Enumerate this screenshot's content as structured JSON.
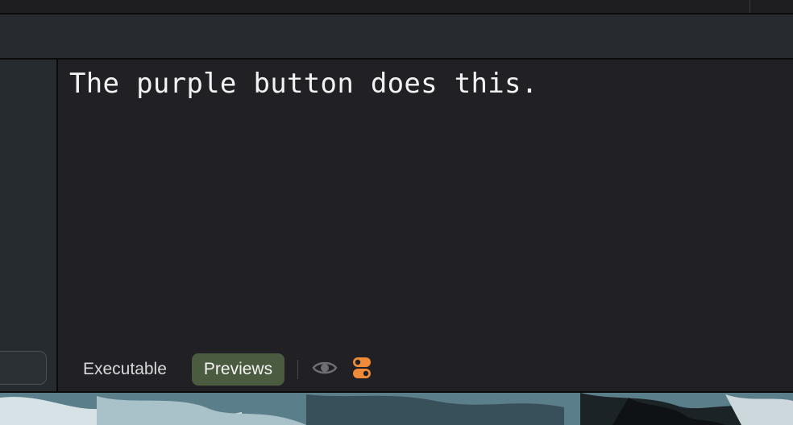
{
  "console": {
    "output": "The purple button does this."
  },
  "bottom_bar": {
    "tabs": [
      {
        "label": "Executable",
        "selected": false
      },
      {
        "label": "Previews",
        "selected": true
      }
    ],
    "icons": [
      "eye-icon",
      "toggles-icon"
    ]
  },
  "colors": {
    "editor_background": "#212125",
    "selected_tab": "#4b5b40",
    "accent_orange": "#ef8a38",
    "eye_icon": "#6e6e73"
  }
}
